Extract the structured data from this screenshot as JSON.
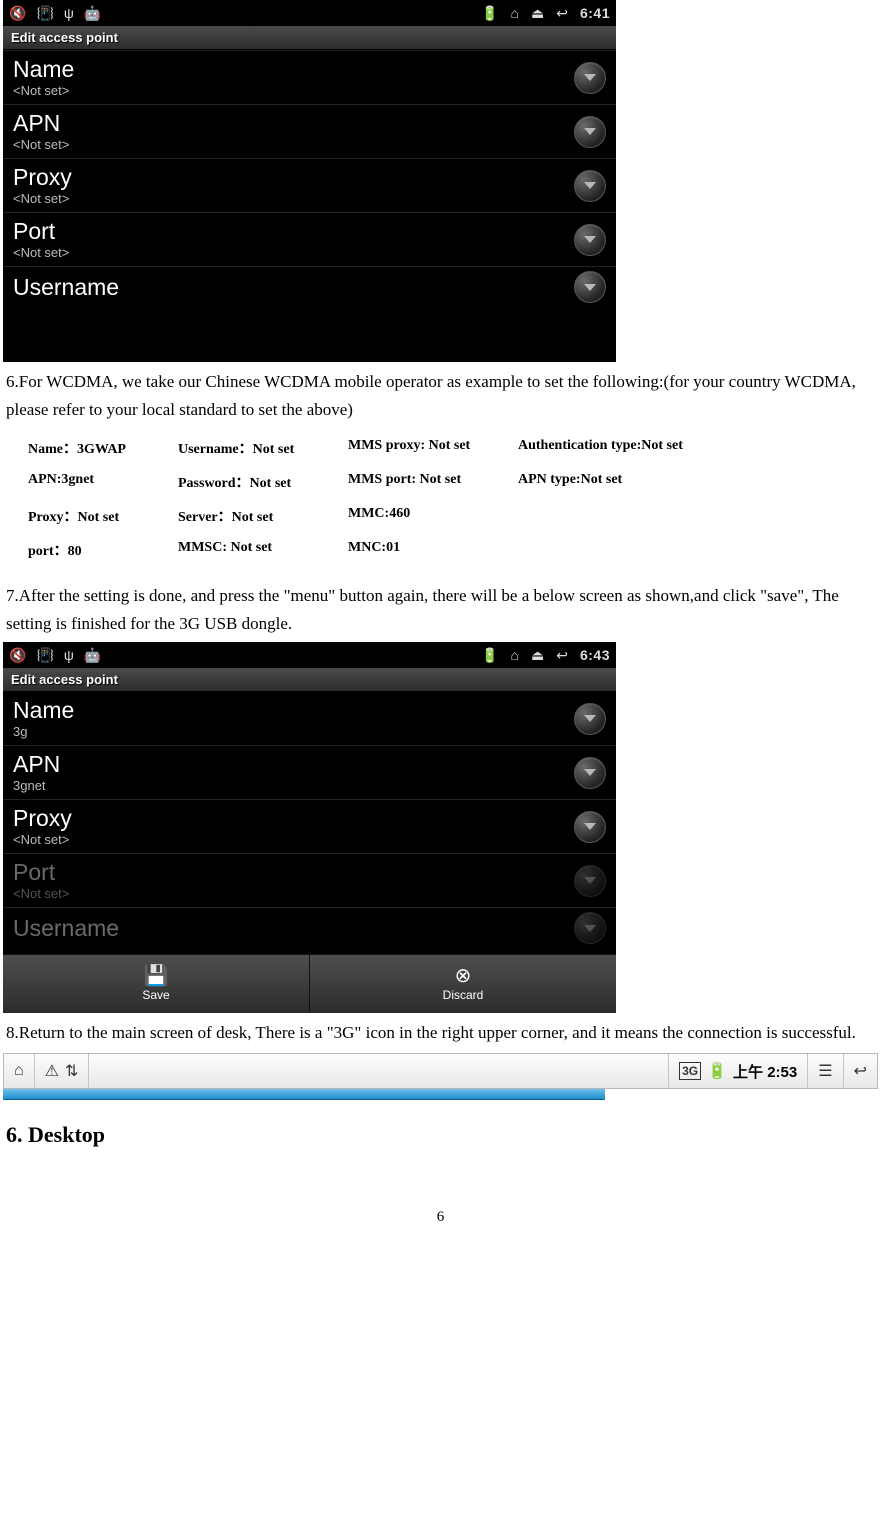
{
  "shot1": {
    "time": "6:41",
    "title": "Edit access point",
    "rows": [
      {
        "label": "Name",
        "sub": "<Not set>"
      },
      {
        "label": "APN",
        "sub": "<Not set>"
      },
      {
        "label": "Proxy",
        "sub": "<Not set>"
      },
      {
        "label": "Port",
        "sub": "<Not set>"
      },
      {
        "label": "Username",
        "sub": null
      }
    ]
  },
  "para6": "6.For WCDMA, we take our Chinese WCDMA mobile operator as example to set the following:(for your country WCDMA, please refer to your local standard to set the above)",
  "settings": {
    "c0": [
      "Name：3GWAP",
      "APN:3gnet",
      "Proxy：Not set",
      "port：80"
    ],
    "c1": [
      "Username：Not set",
      "Password：Not set",
      "Server：Not set",
      "MMSC: Not set"
    ],
    "c2": [
      "MMS proxy: Not set",
      "MMS port: Not set",
      "MMC:460",
      "MNC:01"
    ],
    "c3": [
      "Authentication type:Not set",
      "APN type:Not set",
      "",
      ""
    ]
  },
  "para7": "7.After the setting is done, and press the \"menu\" button again, there will be a below screen as shown,and click \"save\", The setting is finished for the 3G USB dongle.",
  "shot2": {
    "time": "6:43",
    "title": "Edit access point",
    "rows": [
      {
        "label": "Name",
        "sub": "3g"
      },
      {
        "label": "APN",
        "sub": "3gnet"
      },
      {
        "label": "Proxy",
        "sub": "<Not set>"
      },
      {
        "label": "Port",
        "sub": "<Not set>"
      },
      {
        "label": "Username",
        "sub": null
      }
    ],
    "menu": {
      "save": "Save",
      "discard": "Discard"
    }
  },
  "para8": "8.Return to the main screen of desk, There is a \"3G\" icon in the right upper corner, and it means the connection is successful.",
  "topbar": {
    "time": "上午 2:53"
  },
  "section": "6. Desktop",
  "pagenum": "6"
}
